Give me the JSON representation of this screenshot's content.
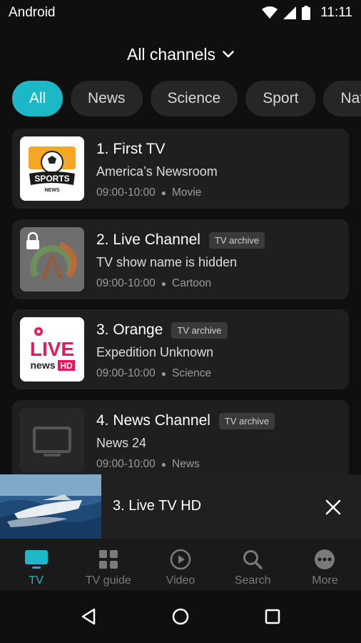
{
  "status_bar": {
    "carrier": "Android",
    "time": "11:11"
  },
  "header": {
    "title": "All channels"
  },
  "chips": [
    "All",
    "News",
    "Science",
    "Sport",
    "Natu"
  ],
  "channels": [
    {
      "name": "1. First TV",
      "show": "America’s Newsroom",
      "time": "09:00-10:00",
      "genre": "Movie",
      "logo_text": "SPORTS",
      "logo_sub": "NEWS"
    },
    {
      "name": "2. Live Channel",
      "badge": "TV archive",
      "show": "TV show name is hidden",
      "time": "09:00-10:00",
      "genre": "Cartoon"
    },
    {
      "name": "3. Orange",
      "badge": "TV archive",
      "show": "Expedition Unknown",
      "time": "09:00-10:00",
      "genre": "Science",
      "logo_text": "LIVE",
      "logo_sub": "news",
      "logo_hd": "HD"
    },
    {
      "name": "4. News Channel",
      "badge": "TV archive",
      "show": "News 24",
      "time": "09:00-10:00",
      "genre": "News"
    }
  ],
  "mini_player": {
    "title": "3. Live TV HD"
  },
  "bottom_nav": [
    {
      "label": "TV",
      "icon": "tv-icon"
    },
    {
      "label": "TV guide",
      "icon": "grid-icon"
    },
    {
      "label": "Video",
      "icon": "play-icon"
    },
    {
      "label": "Search",
      "icon": "search-icon"
    },
    {
      "label": "More",
      "icon": "more-icon"
    }
  ],
  "colors": {
    "accent": "#1cb8c8",
    "background": "#0f0f0f",
    "card": "#1f1f1f",
    "live_pink": "#e8175d"
  }
}
